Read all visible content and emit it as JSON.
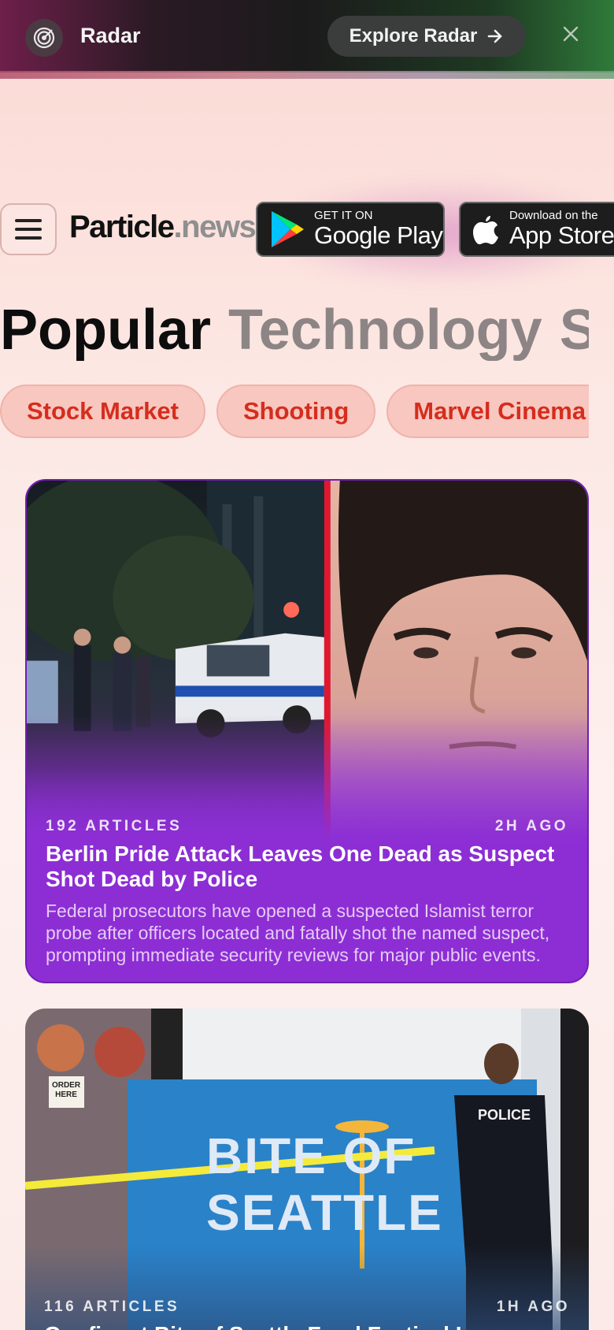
{
  "radar": {
    "logo_icon": "radar-icon",
    "title": "Radar",
    "explore_label": "Explore Radar",
    "explore_icon": "arrow-right-icon",
    "close_icon": "close-icon"
  },
  "header": {
    "menu_icon": "hamburger-menu-icon",
    "brand_main": "Particle",
    "brand_suffix": ".news",
    "google_play": {
      "small": "GET IT ON",
      "big": "Google Play",
      "icon": "google-play-icon"
    },
    "app_store": {
      "small": "Download on the",
      "big": "App Store",
      "icon": "apple-icon"
    }
  },
  "categories": [
    "Popular",
    "Technology",
    "S"
  ],
  "topics": [
    "Stock Market",
    "Shooting",
    "Marvel Cinema"
  ],
  "stories": [
    {
      "articles": "192 ARTICLES",
      "age": "2H AGO",
      "title": "Berlin Pride Attack Leaves One Dead as Suspect Shot Dead by Police",
      "summary": "Federal prosecutors have opened a suspected Islamist terror probe after officers located and fatally shot the named suspect, prompting immediate security reviews for major public events."
    },
    {
      "articles": "116 ARTICLES",
      "age": "1H AGO",
      "title": "Gunfire at Bite of Seattle Food Festival L",
      "banner_text_1": "BITE OF",
      "banner_text_2": "SEATTLE",
      "officer_text": "POLICE",
      "sign_text": "ORDER HERE"
    }
  ],
  "colors": {
    "accent_red": "#d52d1e",
    "card_purple": "#8c2ed4",
    "chip_bg": "#f8c7bf"
  }
}
